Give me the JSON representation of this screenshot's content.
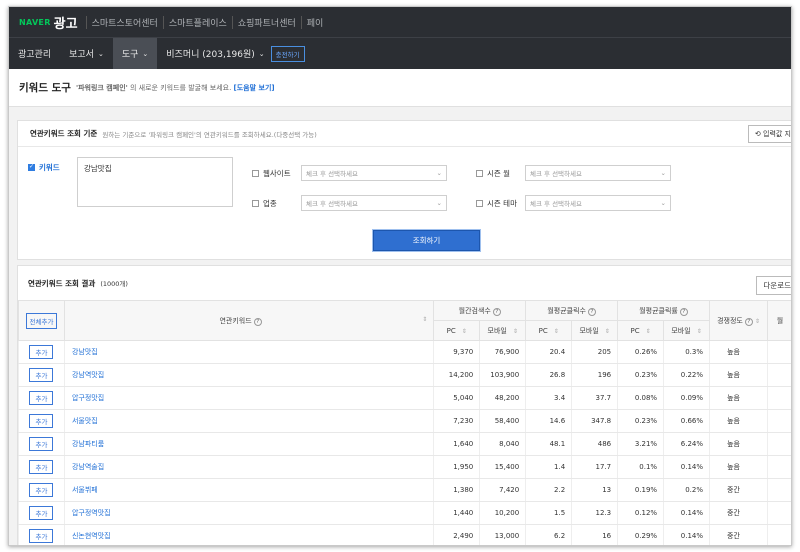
{
  "topbar": {
    "brand_naver": "NAVER",
    "brand_ad": "광고",
    "nav": [
      "스마트스토어센터",
      "스마트플레이스",
      "쇼핑파트너센터",
      "페이"
    ]
  },
  "subbar": {
    "items": [
      {
        "label": "광고관리",
        "chevron": false
      },
      {
        "label": "보고서",
        "chevron": true
      },
      {
        "label": "도구",
        "chevron": true,
        "active": true
      },
      {
        "label": "비즈머니 (203,196원)",
        "chevron": true
      }
    ],
    "charge_label": "충전하기"
  },
  "page": {
    "title": "키워드 도구",
    "desc_quote": "'파워링크 캠페인'",
    "desc_rest": "의 새로운 키워드를 발굴해 보세요.",
    "help_link": "[도움말 보기]"
  },
  "search_panel": {
    "title": "연관키워드 조회 기준",
    "subtitle": "원하는 기준으로 '파워링크 캠페인'의 연관키워드를 조회하세요.(다중선택 가능)",
    "reset_label": "입력값 지",
    "keyword_label": "키워드",
    "keyword_value": "강남맛집",
    "filters": [
      {
        "label": "웹사이트",
        "placeholder": "체크 후 선택하세요"
      },
      {
        "label": "시즌 월",
        "placeholder": "체크 후 선택하세요"
      },
      {
        "label": "업종",
        "placeholder": "체크 후 선택하세요"
      },
      {
        "label": "시즌 테마",
        "placeholder": "체크 후 선택하세요"
      }
    ],
    "search_button": "조회하기"
  },
  "results": {
    "title": "연관키워드 조회 결과",
    "count": "(1000개)",
    "download_label": "다운로드",
    "add_all_label": "전체추가",
    "headers": {
      "keyword": "연관키워드",
      "monthly_search": "월간검색수",
      "avg_clicks": "월평균클릭수",
      "avg_ctr": "월평균클릭률",
      "competition": "경쟁정도",
      "pc": "PC",
      "mobile": "모바일",
      "extra": "월"
    },
    "add_label": "추가",
    "rows": [
      {
        "keyword": "강남맛집",
        "search_pc": "9,370",
        "search_mobile": "76,900",
        "click_pc": "20.4",
        "click_mobile": "205",
        "ctr_pc": "0.26%",
        "ctr_mobile": "0.3%",
        "competition": "높음"
      },
      {
        "keyword": "강남역맛집",
        "search_pc": "14,200",
        "search_mobile": "103,900",
        "click_pc": "26.8",
        "click_mobile": "196",
        "ctr_pc": "0.23%",
        "ctr_mobile": "0.22%",
        "competition": "높음"
      },
      {
        "keyword": "압구정맛집",
        "search_pc": "5,040",
        "search_mobile": "48,200",
        "click_pc": "3.4",
        "click_mobile": "37.7",
        "ctr_pc": "0.08%",
        "ctr_mobile": "0.09%",
        "competition": "높음"
      },
      {
        "keyword": "서울맛집",
        "search_pc": "7,230",
        "search_mobile": "58,400",
        "click_pc": "14.6",
        "click_mobile": "347.8",
        "ctr_pc": "0.23%",
        "ctr_mobile": "0.66%",
        "competition": "높음"
      },
      {
        "keyword": "강남파티룸",
        "search_pc": "1,640",
        "search_mobile": "8,040",
        "click_pc": "48.1",
        "click_mobile": "486",
        "ctr_pc": "3.21%",
        "ctr_mobile": "6.24%",
        "competition": "높음"
      },
      {
        "keyword": "강남역술집",
        "search_pc": "1,950",
        "search_mobile": "15,400",
        "click_pc": "1.4",
        "click_mobile": "17.7",
        "ctr_pc": "0.1%",
        "ctr_mobile": "0.14%",
        "competition": "높음"
      },
      {
        "keyword": "서울뷔페",
        "search_pc": "1,380",
        "search_mobile": "7,420",
        "click_pc": "2.2",
        "click_mobile": "13",
        "ctr_pc": "0.19%",
        "ctr_mobile": "0.2%",
        "competition": "중간"
      },
      {
        "keyword": "압구정역맛집",
        "search_pc": "1,440",
        "search_mobile": "10,200",
        "click_pc": "1.5",
        "click_mobile": "12.3",
        "ctr_pc": "0.12%",
        "ctr_mobile": "0.14%",
        "competition": "중간"
      },
      {
        "keyword": "신논현역맛집",
        "search_pc": "2,490",
        "search_mobile": "13,000",
        "click_pc": "6.2",
        "click_mobile": "16",
        "ctr_pc": "0.29%",
        "ctr_mobile": "0.14%",
        "competition": "중간"
      }
    ]
  },
  "colors": {
    "topbar_bg": "#2b2e33",
    "brand_green": "#03c75a",
    "link_blue": "#1f6fd6",
    "primary_button": "#2f6fd0"
  }
}
